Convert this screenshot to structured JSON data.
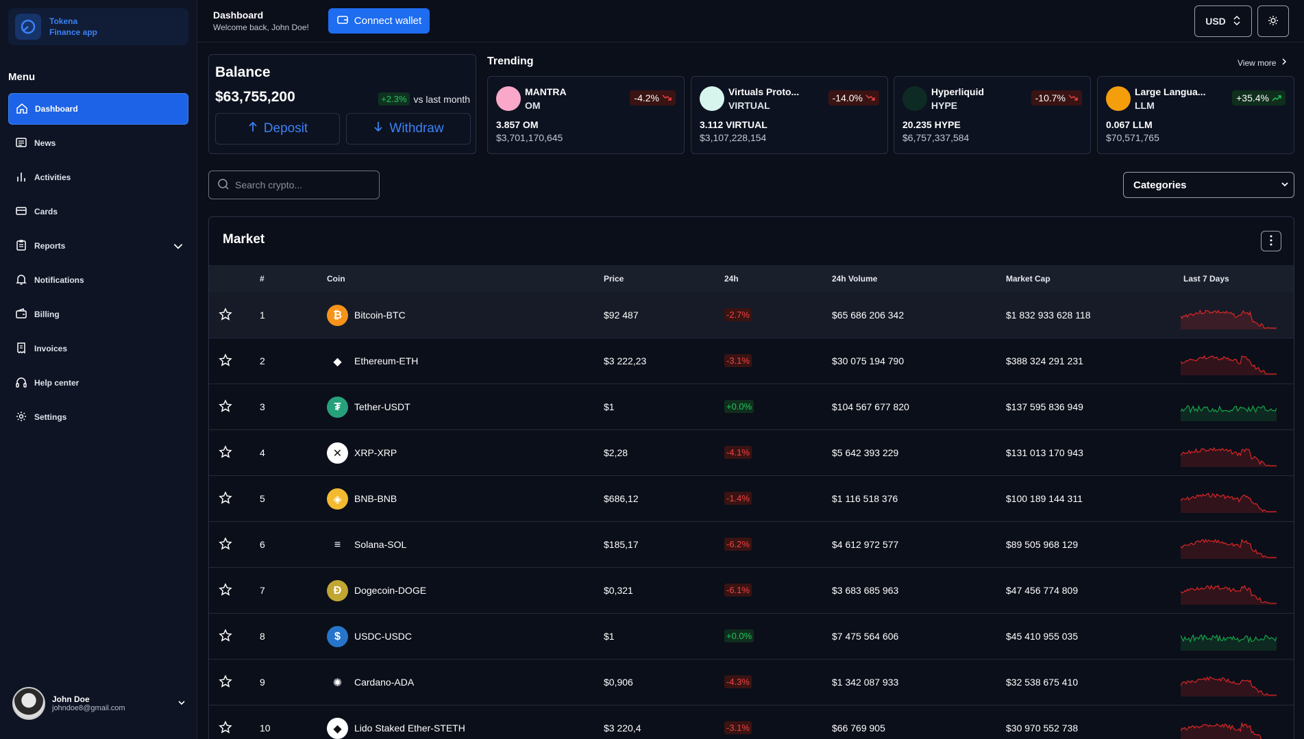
{
  "brand": {
    "line1": "Tokena",
    "line2": "Finance app"
  },
  "menu": {
    "title": "Menu",
    "items": [
      {
        "label": "Dashboard",
        "icon": "home-icon",
        "active": true
      },
      {
        "label": "News",
        "icon": "newspaper-icon"
      },
      {
        "label": "Activities",
        "icon": "bar-chart-icon"
      },
      {
        "label": "Cards",
        "icon": "credit-card-icon"
      },
      {
        "label": "Reports",
        "icon": "clipboard-icon",
        "expandable": true
      },
      {
        "label": "Notifications",
        "icon": "bell-icon"
      },
      {
        "label": "Billing",
        "icon": "wallet-icon"
      },
      {
        "label": "Invoices",
        "icon": "receipt-icon"
      },
      {
        "label": "Help center",
        "icon": "headphones-icon"
      },
      {
        "label": "Settings",
        "icon": "gear-icon"
      }
    ]
  },
  "user": {
    "name": "John Doe",
    "email": "johndoe8@gmail.com"
  },
  "topbar": {
    "title": "Dashboard",
    "subtitle": "Welcome back, John Doe!",
    "connect_label": "Connect wallet",
    "currency": "USD"
  },
  "balance": {
    "title": "Balance",
    "amount": "$63,755,200",
    "change": "+2.3%",
    "change_suffix": "vs last month",
    "deposit_label": "Deposit",
    "withdraw_label": "Withdraw"
  },
  "trending": {
    "title": "Trending",
    "view_more": "View more",
    "cards": [
      {
        "name": "MANTRA",
        "symbol": "OM",
        "change": "-4.2%",
        "direction": "down",
        "price": "3.857 OM",
        "cap": "$3,701,170,645",
        "color": "#f9a8c9"
      },
      {
        "name": "Virtuals Proto...",
        "symbol": "VIRTUAL",
        "change": "-14.0%",
        "direction": "down",
        "price": "3.112 VIRTUAL",
        "cap": "$3,107,228,154",
        "color": "#d7f5ec"
      },
      {
        "name": "Hyperliquid",
        "symbol": "HYPE",
        "change": "-10.7%",
        "direction": "down",
        "price": "20.235 HYPE",
        "cap": "$6,757,337,584",
        "color": "#0e2a24"
      },
      {
        "name": "Large Langua...",
        "symbol": "LLM",
        "change": "+35.4%",
        "direction": "up",
        "price": "0.067 LLM",
        "cap": "$70,571,765",
        "color": "#f59e0b"
      }
    ]
  },
  "search": {
    "placeholder": "Search crypto..."
  },
  "categories": {
    "selected": "Categories"
  },
  "market": {
    "title": "Market",
    "columns": [
      "#",
      "Coin",
      "Price",
      "24h",
      "24h Volume",
      "Market Cap",
      "Last 7 Days"
    ],
    "rows": [
      {
        "rank": "1",
        "coin": "Bitcoin-BTC",
        "price": "$92 487",
        "change": "-2.7%",
        "direction": "down",
        "volume": "$65 686 206 342",
        "cap": "$1 832 933 628 118",
        "color": "#f7931a",
        "glyph": "₿"
      },
      {
        "rank": "2",
        "coin": "Ethereum-ETH",
        "price": "$3 222,23",
        "change": "-3.1%",
        "direction": "down",
        "volume": "$30 075 194 790",
        "cap": "$388 324 291 231",
        "color": "#0b0f19",
        "glyph": "◆"
      },
      {
        "rank": "3",
        "coin": "Tether-USDT",
        "price": "$1",
        "change": "+0.0%",
        "direction": "up",
        "volume": "$104 567 677 820",
        "cap": "$137 595 836 949",
        "color": "#26a17b",
        "glyph": "₮"
      },
      {
        "rank": "4",
        "coin": "XRP-XRP",
        "price": "$2,28",
        "change": "-4.1%",
        "direction": "down",
        "volume": "$5 642 393 229",
        "cap": "$131 013 170 943",
        "color": "#ffffff",
        "glyph": "✕"
      },
      {
        "rank": "5",
        "coin": "BNB-BNB",
        "price": "$686,12",
        "change": "-1.4%",
        "direction": "down",
        "volume": "$1 116 518 376",
        "cap": "$100 189 144 311",
        "color": "#f3ba2f",
        "glyph": "◈"
      },
      {
        "rank": "6",
        "coin": "Solana-SOL",
        "price": "$185,17",
        "change": "-6.2%",
        "direction": "down",
        "volume": "$4 612 972 577",
        "cap": "$89 505 968 129",
        "color": "#0b0f19",
        "glyph": "≡"
      },
      {
        "rank": "7",
        "coin": "Dogecoin-DOGE",
        "price": "$0,321",
        "change": "-6.1%",
        "direction": "down",
        "volume": "$3 683 685 963",
        "cap": "$47 456 774 809",
        "color": "#c2a633",
        "glyph": "Ð"
      },
      {
        "rank": "8",
        "coin": "USDC-USDC",
        "price": "$1",
        "change": "+0.0%",
        "direction": "up",
        "volume": "$7 475 564 606",
        "cap": "$45 410 955 035",
        "color": "#2775ca",
        "glyph": "$"
      },
      {
        "rank": "9",
        "coin": "Cardano-ADA",
        "price": "$0,906",
        "change": "-4.3%",
        "direction": "down",
        "volume": "$1 342 087 933",
        "cap": "$32 538 675 410",
        "color": "#0b0f19",
        "glyph": "✺"
      },
      {
        "rank": "10",
        "coin": "Lido Staked Ether-STETH",
        "price": "$3 220,4",
        "change": "-3.1%",
        "direction": "down",
        "volume": "$66 769 905",
        "cap": "$30 970 552 738",
        "color": "#ffffff",
        "glyph": "◆"
      }
    ]
  }
}
